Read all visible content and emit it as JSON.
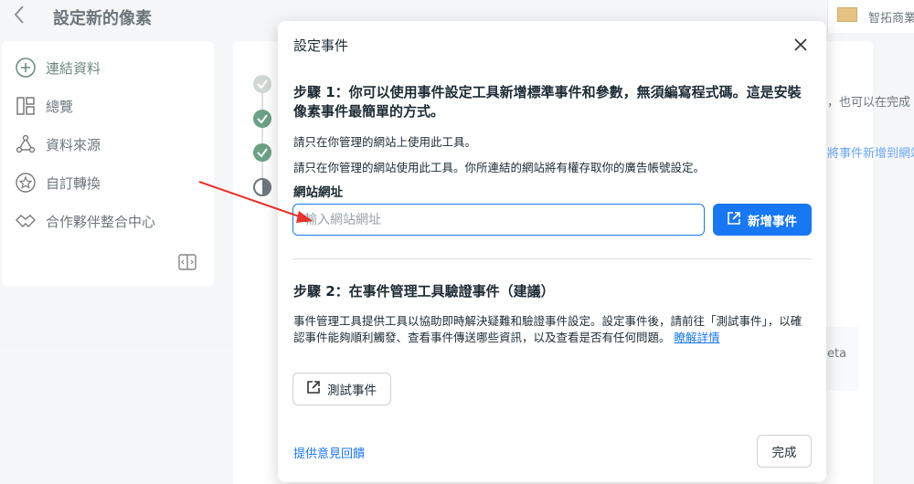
{
  "header": {
    "title": "設定新的像素",
    "business_name": "智拓商業"
  },
  "sidebar": {
    "items": [
      {
        "label": "連結資料"
      },
      {
        "label": "總覽"
      },
      {
        "label": "資料來源"
      },
      {
        "label": "自訂轉換"
      },
      {
        "label": "合作夥伴整合中心"
      }
    ]
  },
  "background": {
    "snippet_1": "，也可以在完成",
    "snippet_2": "將事件新增到網站",
    "snippet_3": "eta"
  },
  "modal": {
    "title": "設定事件",
    "step1": {
      "heading": "步驟 1：你可以使用事件設定工具新增標準事件和參數，無須編寫程式碼。這是安裝像素事件最簡單的方式。",
      "note_1": "請只在你管理的網站上使用此工具。",
      "note_2": "請只在你管理的網站使用此工具。你所連結的網站將有權存取你的廣告帳號設定。",
      "url_label": "網站網址",
      "url_placeholder": "輸入網站網址",
      "url_value": "",
      "add_button": "新增事件"
    },
    "step2": {
      "heading": "步驟 2：在事件管理工具驗證事件（建議）",
      "description": "事件管理工具提供工具以協助即時解決疑難和驗證事件設定。設定事件後，請前往「測試事件」，以確認事件能夠順利觸發、查看事件傳送哪些資訊，以及查看是否有任何問題。",
      "learn_more": "瞭解詳情",
      "test_button": "測試事件"
    },
    "feedback_link": "提供意見回饋",
    "done_button": "完成"
  },
  "colors": {
    "accent": "#1877f2",
    "success": "#1d6f42",
    "annotation_arrow": "#e8322a"
  }
}
